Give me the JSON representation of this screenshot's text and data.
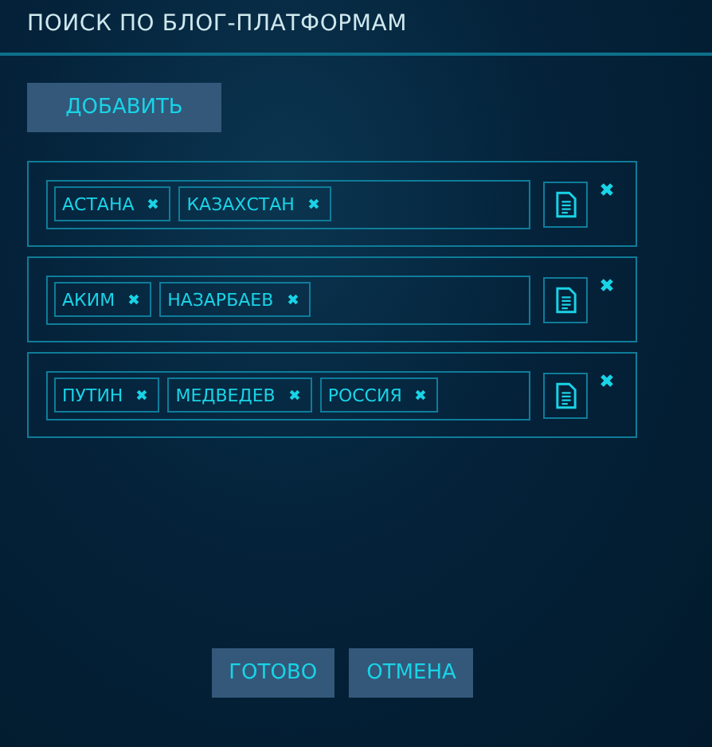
{
  "dialog": {
    "title": "ПОИСК ПО БЛОГ-ПЛАТФОРМАМ",
    "add_button": "ДОБАВИТЬ",
    "queries": [
      {
        "tags": [
          "АСТАНА",
          "КАЗАХСТАН"
        ]
      },
      {
        "tags": [
          "АКИМ",
          "НАЗАРБАЕВ"
        ]
      },
      {
        "tags": [
          "ПУТИН",
          "МЕДВЕДЕВ",
          "РОССИЯ"
        ]
      }
    ],
    "buttons": [
      "ГОТОВО",
      "ОТМЕНА"
    ]
  }
}
